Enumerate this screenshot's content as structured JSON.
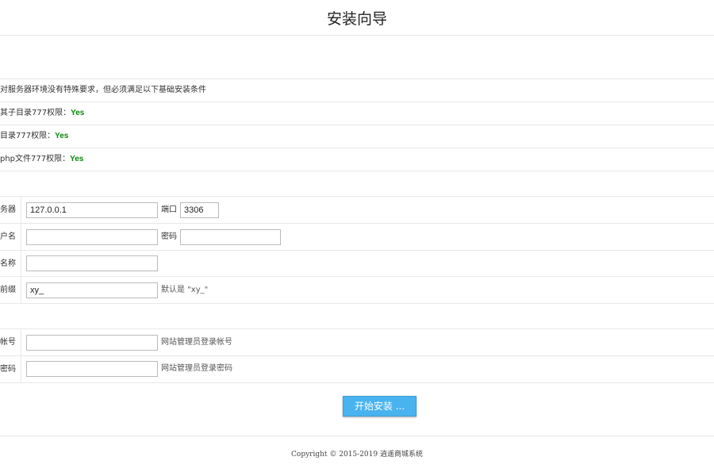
{
  "header": {
    "title": "安装向导"
  },
  "requirements": {
    "intro": "对服务器环境没有特殊要求，但必须满足以下基础安装条件",
    "items": [
      {
        "label": "其子目录777权限：",
        "status": "Yes"
      },
      {
        "label": "目录777权限：",
        "status": "Yes"
      },
      {
        "label": "php文件777权限：",
        "status": "Yes"
      }
    ]
  },
  "database": {
    "server_label": "务器",
    "server_value": "127.0.0.1",
    "port_label": "端口",
    "port_value": "3306",
    "user_label": "户名",
    "user_value": "",
    "password_label": "密码",
    "password_value": "",
    "name_label": "名称",
    "name_value": "",
    "prefix_label": "前缀",
    "prefix_value": "xy_",
    "prefix_hint": "默认是 \"xy_\""
  },
  "admin": {
    "account_label": "帐号",
    "account_value": "",
    "account_hint": "网站管理员登录帐号",
    "password_label": "密码",
    "password_value": "",
    "password_hint": "网站管理员登录密码"
  },
  "actions": {
    "install_label": "开始安装 ..."
  },
  "footer": {
    "copyright": "Copyright © 2015-2019 逍遥商城系统"
  },
  "colors": {
    "ok": "#0a8a0a",
    "button": "#49b3ef"
  }
}
